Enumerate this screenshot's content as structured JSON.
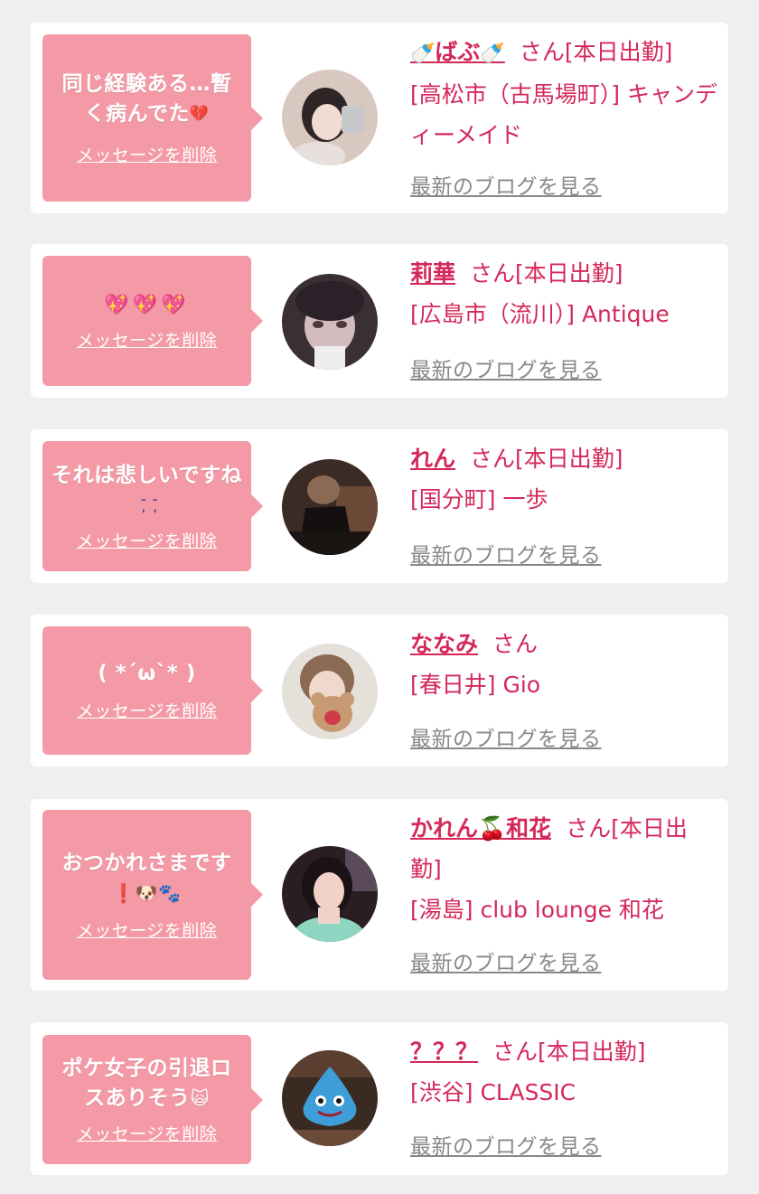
{
  "items": [
    {
      "message": "同じ経験ある…暫く病んでた",
      "message_emoji": "💔",
      "delete_label": "メッセージを削除",
      "name": "ばぶ",
      "san": "さん[本日出勤]",
      "shop": "[高松市（古馬場町）] キャンディーメイド",
      "blog_label": "最新のブログを見る",
      "avatar_colors": [
        "#3a3030",
        "#d9c8c0"
      ]
    },
    {
      "message": "",
      "message_emoji": "💖💖💖",
      "delete_label": "メッセージを削除",
      "name": "莉華",
      "san": "さん[本日出勤]",
      "shop": "[広島市（流川）] Antique",
      "blog_label": "最新のブログを見る",
      "avatar_colors": [
        "#2a2228",
        "#c9b4b6"
      ]
    },
    {
      "message": "それは悲しいですね",
      "message_emoji": "˘̩̩̩ ˘̩̩̩",
      "delete_label": "メッセージを削除",
      "name": "れん",
      "san": "さん[本日出勤]",
      "shop": "[国分町] 一歩",
      "blog_label": "最新のブログを見る",
      "avatar_colors": [
        "#1c1614",
        "#7a5a44"
      ]
    },
    {
      "message": "( *´ω`* )",
      "message_emoji": "",
      "delete_label": "メッセージを削除",
      "name": "ななみ",
      "san": "さん",
      "shop": "[春日井] Gio",
      "blog_label": "最新のブログを見る",
      "avatar_colors": [
        "#e8e2dc",
        "#b08868"
      ]
    },
    {
      "message": "おつかれさまです",
      "message_emoji": "❗🐶🐾",
      "delete_label": "メッセージを削除",
      "name": "かれん🍒和花",
      "san": "さん[本日出勤]",
      "shop": "[湯島] club lounge 和花",
      "blog_label": "最新のブログを見る",
      "avatar_colors": [
        "#2a1e22",
        "#8fd6c2"
      ]
    },
    {
      "message": "ポケ女子の引退ロスありそう",
      "message_emoji": "🙀",
      "delete_label": "メッセージを削除",
      "name": "？？？",
      "san": "さん[本日出勤]",
      "shop": "[渋谷] CLASSIC",
      "blog_label": "最新のブログを見る",
      "avatar_colors": [
        "#3a2a22",
        "#3e9fd8"
      ]
    }
  ]
}
